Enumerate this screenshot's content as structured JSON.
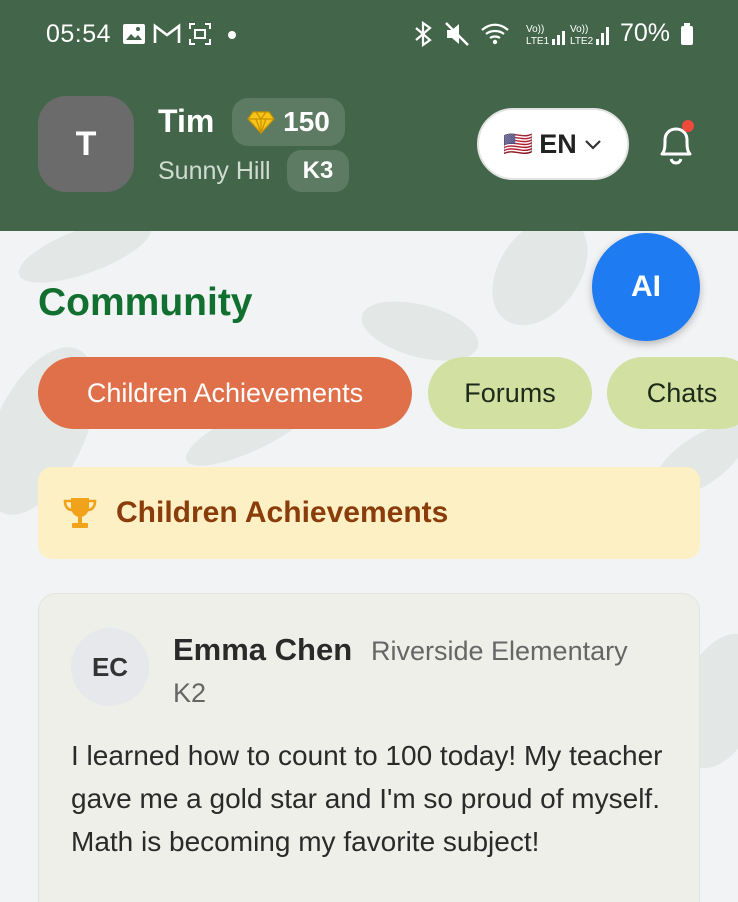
{
  "status_bar": {
    "time": "05:54",
    "battery": "70%",
    "icons": [
      "gallery-icon",
      "gmail-icon",
      "screenshot-icon",
      "dot-icon",
      "bluetooth-icon",
      "mute-icon",
      "wifi-icon",
      "signal-icon",
      "battery-icon"
    ]
  },
  "header": {
    "avatar_initial": "T",
    "user_name": "Tim",
    "points": "150",
    "school": "Sunny Hill",
    "grade": "K3",
    "language": "EN",
    "flag": "🇺🇸"
  },
  "page": {
    "title": "Community",
    "ai_button": "AI"
  },
  "tabs": [
    {
      "label": "Children Achievements",
      "active": true
    },
    {
      "label": "Forums",
      "active": false
    },
    {
      "label": "Chats",
      "active": false
    }
  ],
  "section": {
    "title": "Children Achievements"
  },
  "post": {
    "avatar_initials": "EC",
    "author": "Emma Chen",
    "school": "Riverside Elementary",
    "grade": "K2",
    "text": "I learned how to count to 100 today! My teacher gave me a gold star and I'm so proud of myself. Math is becoming my favorite subject!"
  },
  "colors": {
    "header": "#43664a",
    "title": "#11702f",
    "active_tab": "#e0704a",
    "inactive_tab": "#d2e0a2",
    "ai_button": "#1e7bf2",
    "banner": "#fdf0c4",
    "banner_text": "#8a3c0b"
  }
}
